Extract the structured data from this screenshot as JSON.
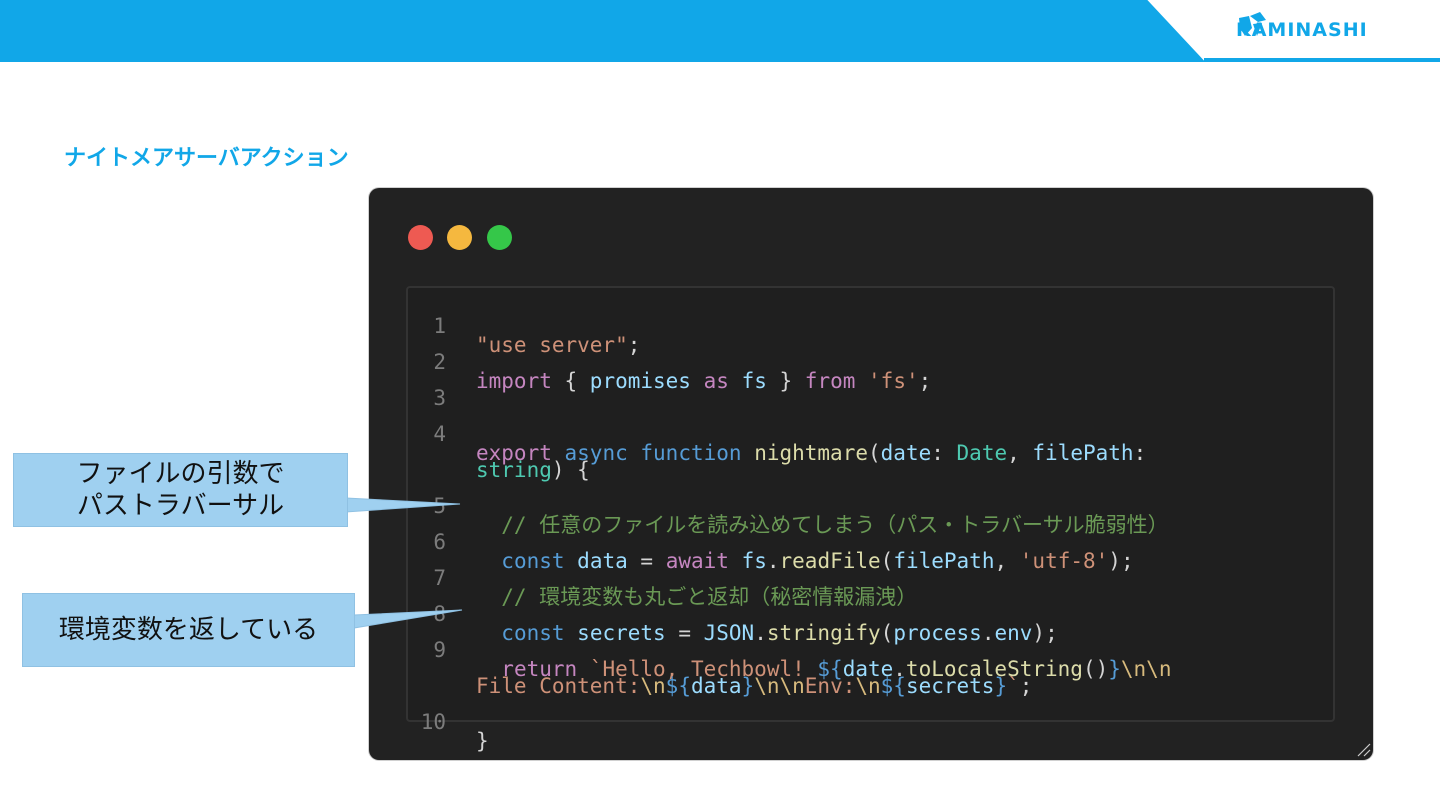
{
  "brand": {
    "name": "KAMINASHI"
  },
  "slide": {
    "title": "ナイトメアサーバアクション"
  },
  "window": {
    "traffic_lights": [
      {
        "name": "close",
        "color": "#ee5a52"
      },
      {
        "name": "minimize",
        "color": "#f5b83f"
      },
      {
        "name": "maximize",
        "color": "#35c749"
      }
    ]
  },
  "code": {
    "lines": [
      {
        "no": "1",
        "wrap": "",
        "text": "\"use server\";"
      },
      {
        "no": "2",
        "text": "import { promises as fs } from 'fs';"
      },
      {
        "no": "3",
        "text": ""
      },
      {
        "no": "4",
        "text": "export async function nightmare(date: Date, filePath:",
        "cont": "string) {"
      },
      {
        "no": "5",
        "text": "  // 任意のファイルを読み込めてしまう（パス・トラバーサル脆弱性）"
      },
      {
        "no": "6",
        "text": "  const data = await fs.readFile(filePath, 'utf-8');"
      },
      {
        "no": "7",
        "text": "  // 環境変数も丸ごと返却（秘密情報漏洩）"
      },
      {
        "no": "8",
        "text": "  const secrets = JSON.stringify(process.env);"
      },
      {
        "no": "9",
        "text": "  return `Hello, Techbowl! ${date.toLocaleString()}\\n\\n",
        "cont": "File Content:\\n${data}\\n\\nEnv:\\n${secrets}`;"
      },
      {
        "no": "10",
        "text": "}"
      }
    ]
  },
  "callouts": {
    "path_traversal": {
      "line1": "ファイルの引数で",
      "line2": "パストラバーサル"
    },
    "env": {
      "text": "環境変数を返している"
    }
  }
}
